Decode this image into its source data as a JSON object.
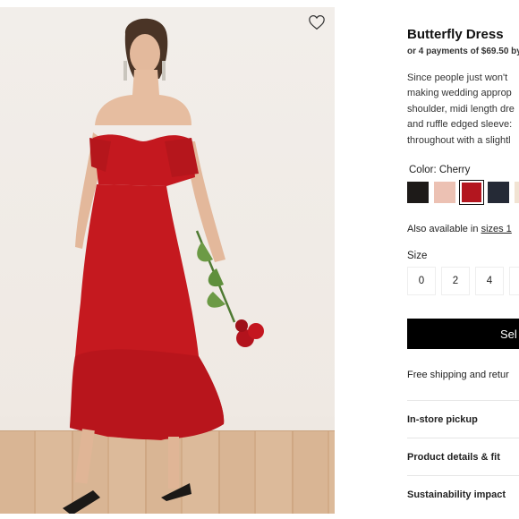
{
  "product": {
    "title": "Butterfly Dress",
    "payments": "or 4 payments of $69.50 by",
    "description": [
      "Since people just won't",
      "making wedding approp",
      "shoulder, midi length dre",
      "and ruffle edged sleeve:",
      "throughout with a slightl"
    ]
  },
  "color": {
    "label": "Color: Cherry",
    "swatches": [
      "#1d1a18",
      "#ecc1b3",
      "#b3161f",
      "#252a36",
      "#f1e3d3"
    ],
    "selected_index": 2
  },
  "availability": {
    "prefix": "Also available in ",
    "link": "sizes 1"
  },
  "size": {
    "label": "Size",
    "options": [
      "0",
      "2",
      "4",
      ""
    ]
  },
  "cta": {
    "label": "Sel"
  },
  "shipping": "Free shipping and retur",
  "accordions": [
    "In-store pickup",
    "Product details & fit",
    "Sustainability impact"
  ]
}
